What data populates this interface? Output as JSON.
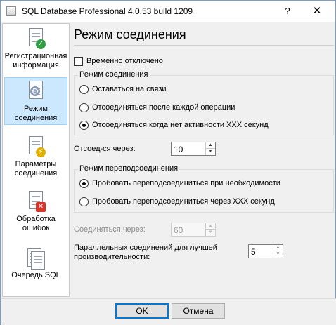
{
  "window": {
    "title": "SQL Database Professional 4.0.53 build 1209",
    "help_label": "?",
    "close_label": "✕"
  },
  "sidebar": {
    "items": [
      {
        "label": "Регистрационная информация",
        "icon": "registration-page-check-icon",
        "selected": false
      },
      {
        "label": "Режим соединения",
        "icon": "connection-mode-gear-icon",
        "selected": true
      },
      {
        "label": "Параметры соединения",
        "icon": "connection-params-page-icon",
        "selected": false
      },
      {
        "label": "Обработка ошибок",
        "icon": "error-handling-page-icon",
        "selected": false
      },
      {
        "label": "Очередь SQL",
        "icon": "sql-queue-icon",
        "selected": false
      }
    ]
  },
  "main": {
    "title": "Режим соединения",
    "temp_disabled_label": "Временно отключено",
    "temp_disabled_checked": false,
    "connection_mode": {
      "caption": "Режим соединения",
      "options": [
        {
          "label": "Оставаться на связи",
          "checked": false
        },
        {
          "label": "Отсоединяться после каждой операции",
          "checked": false
        },
        {
          "label": "Отсоединяться когда нет активности XXX секунд",
          "checked": true
        }
      ]
    },
    "disconnect_after": {
      "label": "Отсоед-ся через:",
      "value": "10"
    },
    "reconnect_mode": {
      "caption": "Режим переподсоединения",
      "options": [
        {
          "label": "Пробовать переподсоединиться при необходимости",
          "checked": true
        },
        {
          "label": "Пробовать переподсоединиться через XXX секунд",
          "checked": false
        }
      ]
    },
    "connect_after": {
      "label": "Соединяться через:",
      "value": "60",
      "disabled": true
    },
    "parallel": {
      "label": "Параллельных соединений для лучшей производительности:",
      "value": "5"
    }
  },
  "footer": {
    "ok_label": "OK",
    "cancel_label": "Отмена"
  },
  "colors": {
    "selection_bg": "#cce8ff",
    "default_button_border": "#0078d7"
  }
}
